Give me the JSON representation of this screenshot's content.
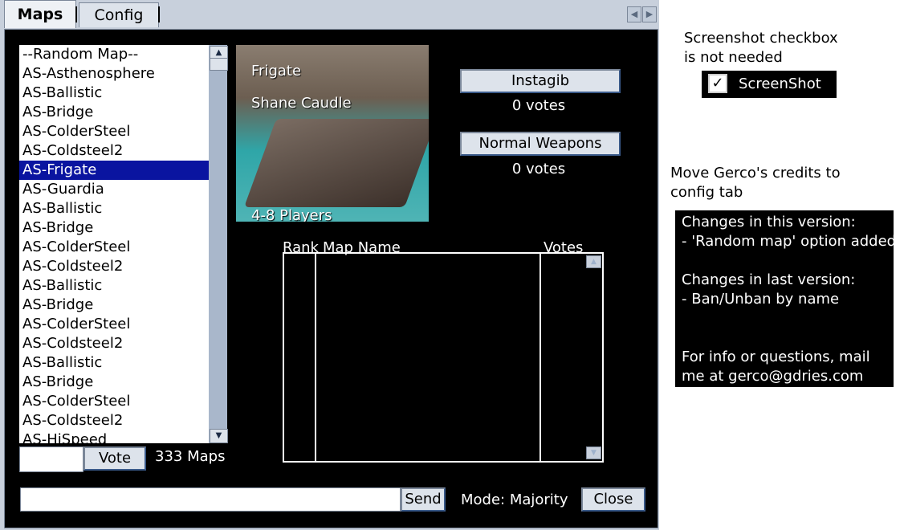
{
  "tabs": [
    {
      "label": "Maps"
    },
    {
      "label": "Config"
    }
  ],
  "map_list": {
    "items": [
      "--Random Map--",
      "AS-Asthenosphere",
      "AS-Ballistic",
      "AS-Bridge",
      "AS-ColderSteel",
      "AS-Coldsteel2",
      "AS-Frigate",
      "AS-Guardia",
      "AS-Ballistic",
      "AS-Bridge",
      "AS-ColderSteel",
      "AS-Coldsteel2",
      "AS-Ballistic",
      "AS-Bridge",
      "AS-ColderSteel",
      "AS-Coldsteel2",
      "AS-Ballistic",
      "AS-Bridge",
      "AS-ColderSteel",
      "AS-Coldsteel2",
      "AS-HiSpeed"
    ],
    "selected": "AS-Frigate",
    "count_label": "333 Maps"
  },
  "vote_button": "Vote",
  "preview": {
    "map_name": "Frigate",
    "author": "Shane Caudle",
    "players": "4-8 Players"
  },
  "modes": [
    {
      "label": "Instagib",
      "votes": "0 votes"
    },
    {
      "label": "Normal Weapons",
      "votes": "0 votes"
    }
  ],
  "votes_table": {
    "columns": [
      "Rank",
      "Map Name",
      "Votes"
    ],
    "rows": []
  },
  "chat": {
    "send_label": "Send",
    "mode_label": "Mode: Majority",
    "close_label": "Close"
  },
  "annotations": {
    "screenshot_note": [
      "Screenshot checkbox",
      "is not needed"
    ],
    "screenshot_checkbox_label": "ScreenShot",
    "screenshot_checked": true,
    "credits_note": [
      "Move Gerco's credits to",
      "config tab"
    ],
    "changes_lines": [
      "Changes in this version:",
      "- 'Random map' option added",
      "",
      "Changes in last version:",
      "- Ban/Unban by name",
      "",
      "",
      "For info or questions, mail",
      "me at gerco@gdries.com"
    ]
  },
  "colors": {
    "selection": "#0a14a0",
    "window_frame": "#c8d0dc",
    "panel_bg": "#000000"
  }
}
